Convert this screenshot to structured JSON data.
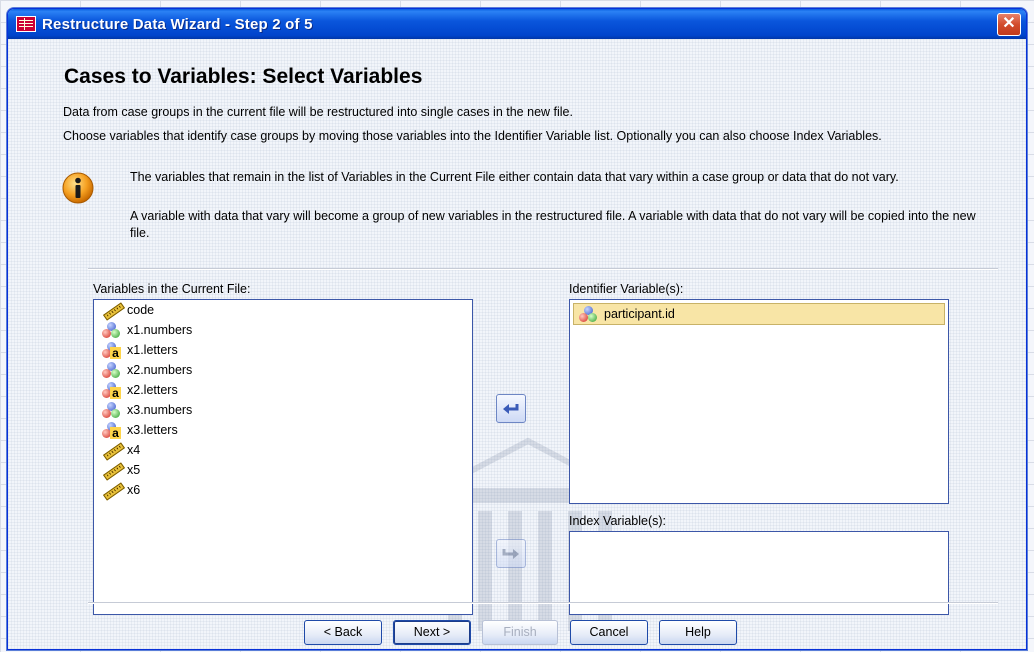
{
  "window": {
    "title": "Restructure Data Wizard - Step 2 of 5",
    "close_glyph": "✕"
  },
  "page": {
    "heading": "Cases to Variables: Select Variables",
    "intro": "Data from case groups in the current file will be restructured into single cases in the new file.",
    "instructions": "Choose variables that identify case groups by moving those variables into the Identifier Variable list.  Optionally you can also choose Index Variables.",
    "info_1": "The variables that remain in the list of Variables in the Current File either contain data that vary within a case group or data that do not vary.",
    "info_2": "A variable with data that vary will become a group of new variables in the restructured file.  A variable with data that do not vary will be copied into the new file."
  },
  "lists": {
    "current_label": "Variables in the Current File:",
    "current_items": [
      {
        "name": "code",
        "icon": "scale-ruler-icon"
      },
      {
        "name": "x1.numbers",
        "icon": "nominal-icon"
      },
      {
        "name": "x1.letters",
        "icon": "nominal-string-icon"
      },
      {
        "name": "x2.numbers",
        "icon": "nominal-icon"
      },
      {
        "name": "x2.letters",
        "icon": "nominal-string-icon"
      },
      {
        "name": "x3.numbers",
        "icon": "nominal-icon"
      },
      {
        "name": "x3.letters",
        "icon": "nominal-string-icon"
      },
      {
        "name": "x4",
        "icon": "scale-ruler-icon"
      },
      {
        "name": "x5",
        "icon": "scale-ruler-icon"
      },
      {
        "name": "x6",
        "icon": "scale-ruler-icon"
      }
    ],
    "identifier_label": "Identifier Variable(s):",
    "identifier_items": [
      {
        "name": "participant.id",
        "icon": "nominal-icon",
        "selected": true
      }
    ],
    "index_label": "Index Variable(s):"
  },
  "buttons": {
    "back": "< Back",
    "next": "Next >",
    "finish": "Finish",
    "cancel": "Cancel",
    "help": "Help"
  },
  "colors": {
    "title_bar": "#0a56dc",
    "list_border": "#3c57a8",
    "selection": "#f8e5a6"
  }
}
